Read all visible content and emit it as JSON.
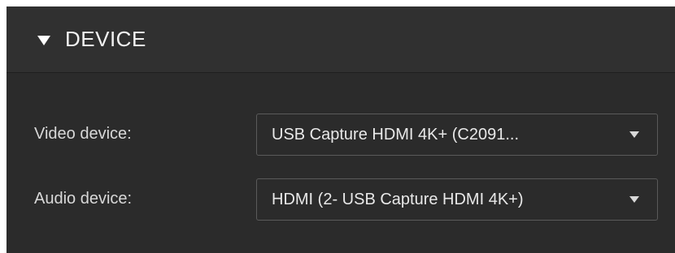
{
  "section": {
    "title": "DEVICE",
    "collapse_icon": "triangle-down-icon",
    "expanded": true
  },
  "fields": {
    "video": {
      "label": "Video device:",
      "value": "USB Capture HDMI 4K+ (C2091...",
      "icon": "chevron-down-icon"
    },
    "audio": {
      "label": "Audio device:",
      "value": "HDMI (2- USB Capture HDMI 4K+)",
      "icon": "chevron-down-icon"
    }
  },
  "colors": {
    "panel_bg": "#2b2b2b",
    "header_bg": "#303030",
    "text": "#e8e8e8",
    "border": "#5a5a5a"
  }
}
